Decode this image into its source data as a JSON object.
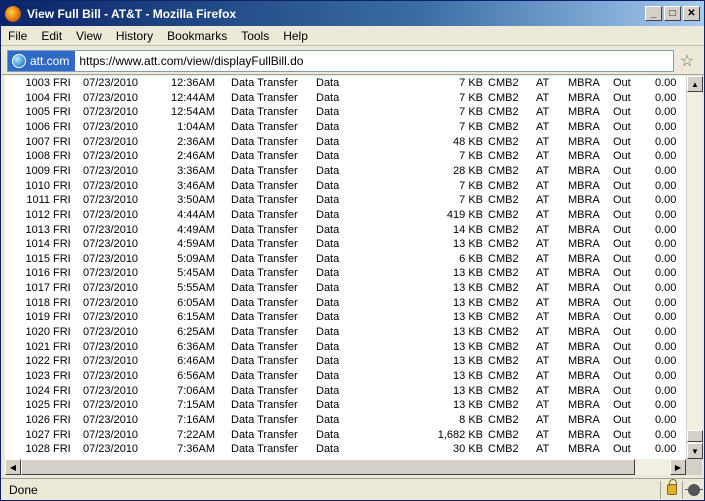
{
  "window": {
    "title": "View Full Bill - AT&T - Mozilla Firefox",
    "min_glyph": "_",
    "max_glyph": "□",
    "close_glyph": "✕"
  },
  "menu": [
    {
      "label": "File"
    },
    {
      "label": "Edit"
    },
    {
      "label": "View"
    },
    {
      "label": "History"
    },
    {
      "label": "Bookmarks"
    },
    {
      "label": "Tools"
    },
    {
      "label": "Help"
    }
  ],
  "nav": {
    "site_identity": "att.com",
    "url": "https://www.att.com/view/displayFullBill.do",
    "bookmark_icon": "star-icon"
  },
  "bill_rows": [
    {
      "num": "1003",
      "day": "FRI",
      "date": "07/23/2010",
      "time": "12:36AM",
      "type": "Data Transfer",
      "cat": "Data",
      "size": "7 KB",
      "net": "CMB2",
      "carrier": "AT",
      "plan": "MBRA",
      "dir": "Out",
      "amt": "0.00"
    },
    {
      "num": "1004",
      "day": "FRI",
      "date": "07/23/2010",
      "time": "12:44AM",
      "type": "Data Transfer",
      "cat": "Data",
      "size": "7 KB",
      "net": "CMB2",
      "carrier": "AT",
      "plan": "MBRA",
      "dir": "Out",
      "amt": "0.00"
    },
    {
      "num": "1005",
      "day": "FRI",
      "date": "07/23/2010",
      "time": "12:54AM",
      "type": "Data Transfer",
      "cat": "Data",
      "size": "7 KB",
      "net": "CMB2",
      "carrier": "AT",
      "plan": "MBRA",
      "dir": "Out",
      "amt": "0.00"
    },
    {
      "num": "1006",
      "day": "FRI",
      "date": "07/23/2010",
      "time": "1:04AM",
      "type": "Data Transfer",
      "cat": "Data",
      "size": "7 KB",
      "net": "CMB2",
      "carrier": "AT",
      "plan": "MBRA",
      "dir": "Out",
      "amt": "0.00"
    },
    {
      "num": "1007",
      "day": "FRI",
      "date": "07/23/2010",
      "time": "2:36AM",
      "type": "Data Transfer",
      "cat": "Data",
      "size": "48 KB",
      "net": "CMB2",
      "carrier": "AT",
      "plan": "MBRA",
      "dir": "Out",
      "amt": "0.00"
    },
    {
      "num": "1008",
      "day": "FRI",
      "date": "07/23/2010",
      "time": "2:46AM",
      "type": "Data Transfer",
      "cat": "Data",
      "size": "7 KB",
      "net": "CMB2",
      "carrier": "AT",
      "plan": "MBRA",
      "dir": "Out",
      "amt": "0.00"
    },
    {
      "num": "1009",
      "day": "FRI",
      "date": "07/23/2010",
      "time": "3:36AM",
      "type": "Data Transfer",
      "cat": "Data",
      "size": "28 KB",
      "net": "CMB2",
      "carrier": "AT",
      "plan": "MBRA",
      "dir": "Out",
      "amt": "0.00"
    },
    {
      "num": "1010",
      "day": "FRI",
      "date": "07/23/2010",
      "time": "3:46AM",
      "type": "Data Transfer",
      "cat": "Data",
      "size": "7 KB",
      "net": "CMB2",
      "carrier": "AT",
      "plan": "MBRA",
      "dir": "Out",
      "amt": "0.00"
    },
    {
      "num": "1011",
      "day": "FRI",
      "date": "07/23/2010",
      "time": "3:50AM",
      "type": "Data Transfer",
      "cat": "Data",
      "size": "7 KB",
      "net": "CMB2",
      "carrier": "AT",
      "plan": "MBRA",
      "dir": "Out",
      "amt": "0.00"
    },
    {
      "num": "1012",
      "day": "FRI",
      "date": "07/23/2010",
      "time": "4:44AM",
      "type": "Data Transfer",
      "cat": "Data",
      "size": "419 KB",
      "net": "CMB2",
      "carrier": "AT",
      "plan": "MBRA",
      "dir": "Out",
      "amt": "0.00"
    },
    {
      "num": "1013",
      "day": "FRI",
      "date": "07/23/2010",
      "time": "4:49AM",
      "type": "Data Transfer",
      "cat": "Data",
      "size": "14 KB",
      "net": "CMB2",
      "carrier": "AT",
      "plan": "MBRA",
      "dir": "Out",
      "amt": "0.00"
    },
    {
      "num": "1014",
      "day": "FRI",
      "date": "07/23/2010",
      "time": "4:59AM",
      "type": "Data Transfer",
      "cat": "Data",
      "size": "13 KB",
      "net": "CMB2",
      "carrier": "AT",
      "plan": "MBRA",
      "dir": "Out",
      "amt": "0.00"
    },
    {
      "num": "1015",
      "day": "FRI",
      "date": "07/23/2010",
      "time": "5:09AM",
      "type": "Data Transfer",
      "cat": "Data",
      "size": "6 KB",
      "net": "CMB2",
      "carrier": "AT",
      "plan": "MBRA",
      "dir": "Out",
      "amt": "0.00"
    },
    {
      "num": "1016",
      "day": "FRI",
      "date": "07/23/2010",
      "time": "5:45AM",
      "type": "Data Transfer",
      "cat": "Data",
      "size": "13 KB",
      "net": "CMB2",
      "carrier": "AT",
      "plan": "MBRA",
      "dir": "Out",
      "amt": "0.00"
    },
    {
      "num": "1017",
      "day": "FRI",
      "date": "07/23/2010",
      "time": "5:55AM",
      "type": "Data Transfer",
      "cat": "Data",
      "size": "13 KB",
      "net": "CMB2",
      "carrier": "AT",
      "plan": "MBRA",
      "dir": "Out",
      "amt": "0.00"
    },
    {
      "num": "1018",
      "day": "FRI",
      "date": "07/23/2010",
      "time": "6:05AM",
      "type": "Data Transfer",
      "cat": "Data",
      "size": "13 KB",
      "net": "CMB2",
      "carrier": "AT",
      "plan": "MBRA",
      "dir": "Out",
      "amt": "0.00"
    },
    {
      "num": "1019",
      "day": "FRI",
      "date": "07/23/2010",
      "time": "6:15AM",
      "type": "Data Transfer",
      "cat": "Data",
      "size": "13 KB",
      "net": "CMB2",
      "carrier": "AT",
      "plan": "MBRA",
      "dir": "Out",
      "amt": "0.00"
    },
    {
      "num": "1020",
      "day": "FRI",
      "date": "07/23/2010",
      "time": "6:25AM",
      "type": "Data Transfer",
      "cat": "Data",
      "size": "13 KB",
      "net": "CMB2",
      "carrier": "AT",
      "plan": "MBRA",
      "dir": "Out",
      "amt": "0.00"
    },
    {
      "num": "1021",
      "day": "FRI",
      "date": "07/23/2010",
      "time": "6:36AM",
      "type": "Data Transfer",
      "cat": "Data",
      "size": "13 KB",
      "net": "CMB2",
      "carrier": "AT",
      "plan": "MBRA",
      "dir": "Out",
      "amt": "0.00"
    },
    {
      "num": "1022",
      "day": "FRI",
      "date": "07/23/2010",
      "time": "6:46AM",
      "type": "Data Transfer",
      "cat": "Data",
      "size": "13 KB",
      "net": "CMB2",
      "carrier": "AT",
      "plan": "MBRA",
      "dir": "Out",
      "amt": "0.00"
    },
    {
      "num": "1023",
      "day": "FRI",
      "date": "07/23/2010",
      "time": "6:56AM",
      "type": "Data Transfer",
      "cat": "Data",
      "size": "13 KB",
      "net": "CMB2",
      "carrier": "AT",
      "plan": "MBRA",
      "dir": "Out",
      "amt": "0.00"
    },
    {
      "num": "1024",
      "day": "FRI",
      "date": "07/23/2010",
      "time": "7:06AM",
      "type": "Data Transfer",
      "cat": "Data",
      "size": "13 KB",
      "net": "CMB2",
      "carrier": "AT",
      "plan": "MBRA",
      "dir": "Out",
      "amt": "0.00"
    },
    {
      "num": "1025",
      "day": "FRI",
      "date": "07/23/2010",
      "time": "7:15AM",
      "type": "Data Transfer",
      "cat": "Data",
      "size": "13 KB",
      "net": "CMB2",
      "carrier": "AT",
      "plan": "MBRA",
      "dir": "Out",
      "amt": "0.00"
    },
    {
      "num": "1026",
      "day": "FRI",
      "date": "07/23/2010",
      "time": "7:16AM",
      "type": "Data Transfer",
      "cat": "Data",
      "size": "8 KB",
      "net": "CMB2",
      "carrier": "AT",
      "plan": "MBRA",
      "dir": "Out",
      "amt": "0.00"
    },
    {
      "num": "1027",
      "day": "FRI",
      "date": "07/23/2010",
      "time": "7:22AM",
      "type": "Data Transfer",
      "cat": "Data",
      "size": "1,682 KB",
      "net": "CMB2",
      "carrier": "AT",
      "plan": "MBRA",
      "dir": "Out",
      "amt": "0.00"
    },
    {
      "num": "1028",
      "day": "FRI",
      "date": "07/23/2010",
      "time": "7:36AM",
      "type": "Data Transfer",
      "cat": "Data",
      "size": "30 KB",
      "net": "CMB2",
      "carrier": "AT",
      "plan": "MBRA",
      "dir": "Out",
      "amt": "0.00"
    }
  ],
  "status": {
    "text": "Done",
    "lock_icon": "lock-icon",
    "addon_icon": "bug-icon"
  }
}
